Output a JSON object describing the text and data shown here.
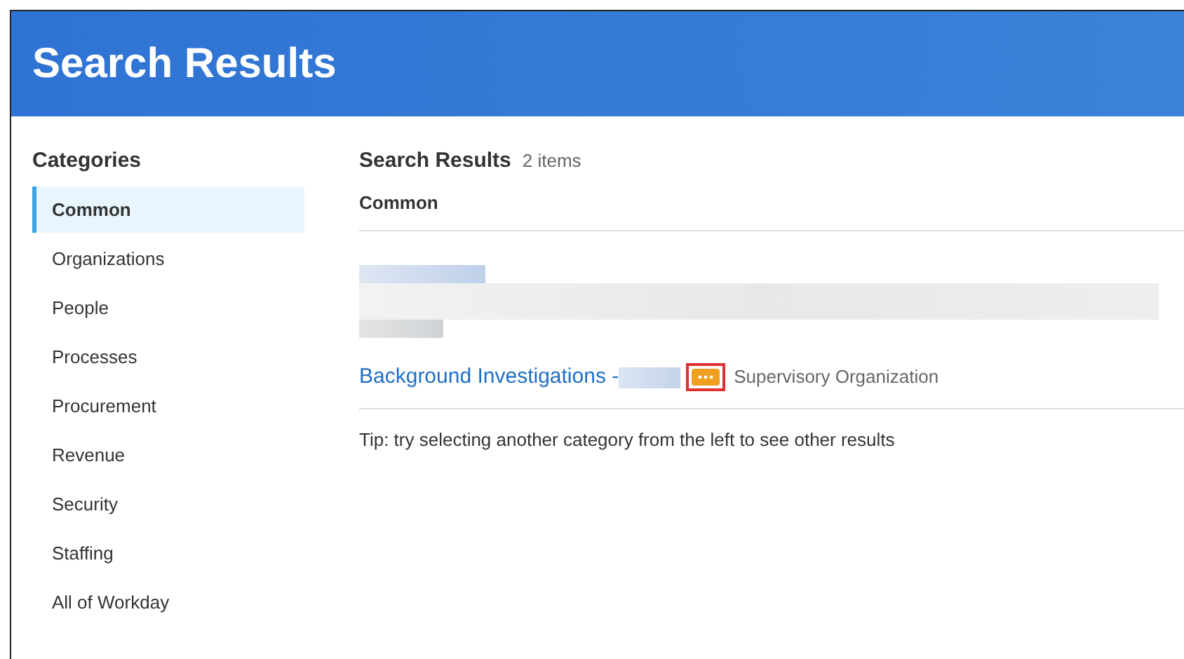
{
  "header": {
    "title": "Search Results"
  },
  "sidebar": {
    "title": "Categories",
    "items": [
      {
        "label": "Common",
        "selected": true
      },
      {
        "label": "Organizations",
        "selected": false
      },
      {
        "label": "People",
        "selected": false
      },
      {
        "label": "Processes",
        "selected": false
      },
      {
        "label": "Procurement",
        "selected": false
      },
      {
        "label": "Revenue",
        "selected": false
      },
      {
        "label": "Security",
        "selected": false
      },
      {
        "label": "Staffing",
        "selected": false
      },
      {
        "label": "All of Workday",
        "selected": false
      }
    ]
  },
  "results": {
    "title": "Search Results",
    "count": "2 items",
    "section": "Common",
    "items": [
      {
        "kind": "redacted"
      },
      {
        "kind": "link",
        "title": "Background Investigations -",
        "type": "Supervisory Organization"
      }
    ],
    "tip": "Tip: try selecting another category from the left to see other results"
  }
}
